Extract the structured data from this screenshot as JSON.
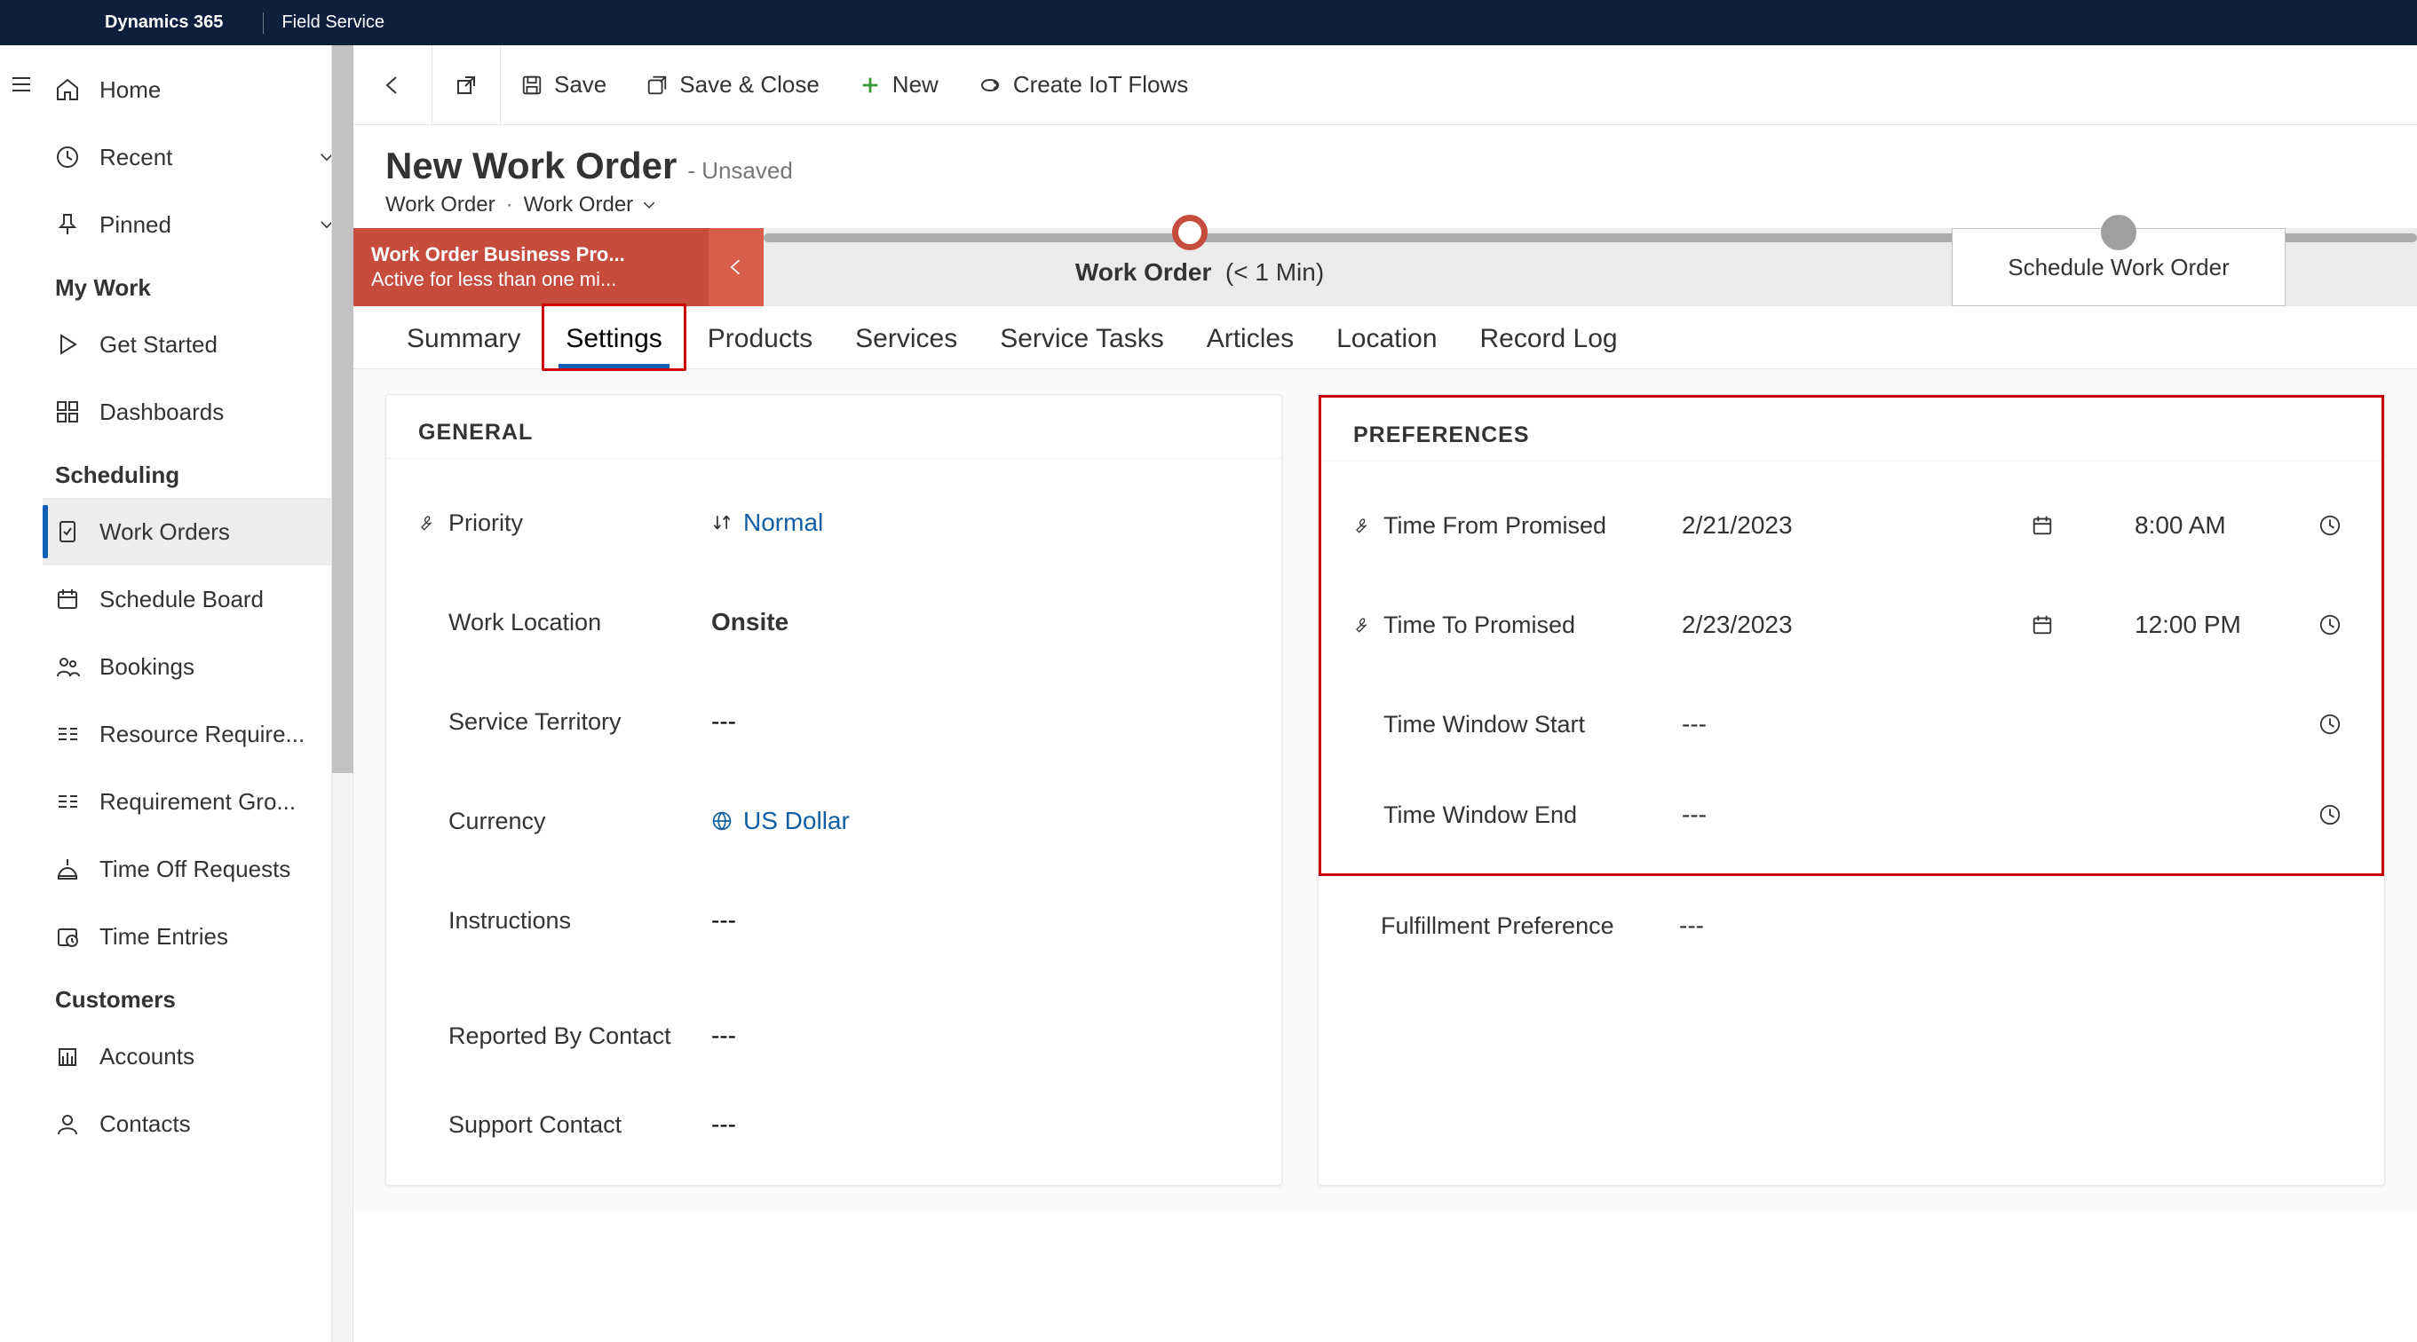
{
  "header": {
    "brand": "Dynamics 365",
    "app": "Field Service"
  },
  "sidebar": {
    "groups": [
      {
        "title": null,
        "items": [
          {
            "label": "Home",
            "icon": "home"
          },
          {
            "label": "Recent",
            "icon": "clock",
            "chev": true
          },
          {
            "label": "Pinned",
            "icon": "pin",
            "chev": true
          }
        ]
      },
      {
        "title": "My Work",
        "items": [
          {
            "label": "Get Started",
            "icon": "play"
          },
          {
            "label": "Dashboards",
            "icon": "dashboard"
          }
        ]
      },
      {
        "title": "Scheduling",
        "items": [
          {
            "label": "Work Orders",
            "icon": "workorder",
            "active": true
          },
          {
            "label": "Schedule Board",
            "icon": "calendar"
          },
          {
            "label": "Bookings",
            "icon": "people"
          },
          {
            "label": "Resource Require...",
            "icon": "requirement"
          },
          {
            "label": "Requirement Gro...",
            "icon": "requirement"
          },
          {
            "label": "Time Off Requests",
            "icon": "timeoff"
          },
          {
            "label": "Time Entries",
            "icon": "timeentry"
          }
        ]
      },
      {
        "title": "Customers",
        "items": [
          {
            "label": "Accounts",
            "icon": "account"
          },
          {
            "label": "Contacts",
            "icon": "contact"
          }
        ]
      }
    ]
  },
  "commandbar": {
    "back": "Back",
    "popout": "Pop out",
    "save": "Save",
    "saveclose": "Save & Close",
    "new": "New",
    "iot": "Create IoT Flows"
  },
  "record": {
    "title": "New Work Order",
    "status": "- Unsaved",
    "entity": "Work Order",
    "form": "Work Order"
  },
  "bpf": {
    "name": "Work Order Business Pro...",
    "status": "Active for less than one mi...",
    "stage1": "Work Order",
    "stage1sub": "(< 1 Min)",
    "stage2": "Schedule Work Order"
  },
  "tabs": [
    "Summary",
    "Settings",
    "Products",
    "Services",
    "Service Tasks",
    "Articles",
    "Location",
    "Record Log"
  ],
  "active_tab": 1,
  "general": {
    "title": "GENERAL",
    "priority": "Normal",
    "work_location": "Onsite",
    "service_territory": "---",
    "currency": "US Dollar",
    "instructions": "---",
    "reported_by": "---",
    "support_contact": "---",
    "labels": {
      "priority": "Priority",
      "work_location": "Work Location",
      "service_territory": "Service Territory",
      "currency": "Currency",
      "instructions": "Instructions",
      "reported_by": "Reported By Contact",
      "support_contact": "Support Contact"
    }
  },
  "prefs": {
    "title": "PREFERENCES",
    "time_from_date": "2/21/2023",
    "time_from_time": "8:00 AM",
    "time_to_date": "2/23/2023",
    "time_to_time": "12:00 PM",
    "time_window_start": "---",
    "time_window_end": "---",
    "fulfillment": "---",
    "labels": {
      "time_from": "Time From Promised",
      "time_to": "Time To Promised",
      "tw_start": "Time Window Start",
      "tw_end": "Time Window End",
      "fulfillment": "Fulfillment Preference"
    }
  }
}
